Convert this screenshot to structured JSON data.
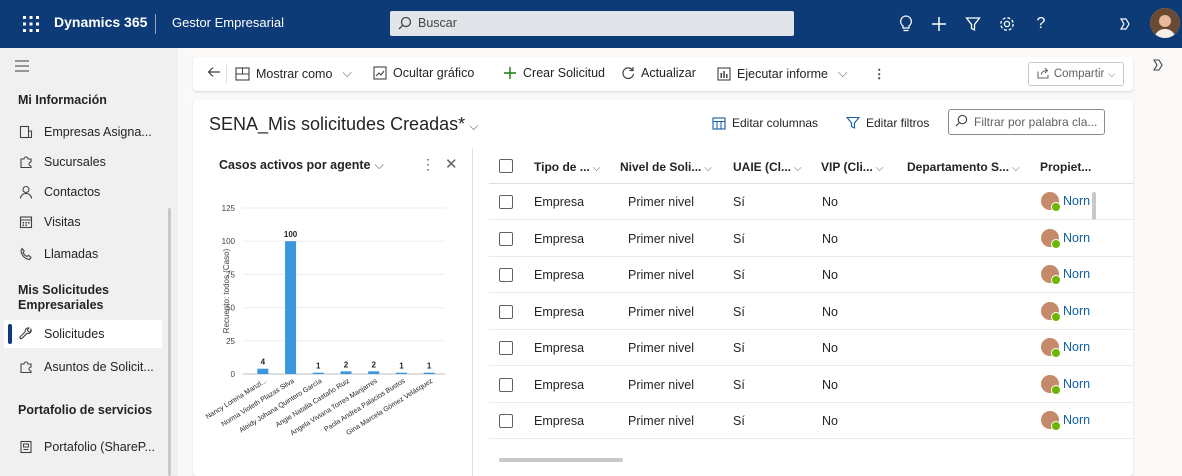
{
  "topbar": {
    "app_name": "Dynamics 365",
    "module": "Gestor Empresarial",
    "search_placeholder": "Buscar"
  },
  "sidebar": {
    "section1": "Mi Información",
    "items1": [
      {
        "label": "Empresas Asigna...",
        "icon": "building-icon"
      },
      {
        "label": "Sucursales",
        "icon": "puzzle-icon"
      },
      {
        "label": "Contactos",
        "icon": "person-icon"
      },
      {
        "label": "Visitas",
        "icon": "calendar-icon"
      },
      {
        "label": "Llamadas",
        "icon": "phone-icon"
      }
    ],
    "section2": "Mis Solicitudes Empresariales",
    "items2": [
      {
        "label": "Solicitudes",
        "icon": "wrench-icon",
        "active": true
      },
      {
        "label": "Asuntos de Solicit...",
        "icon": "puzzle-icon"
      }
    ],
    "section3": "Portafolio de servicios",
    "items3": [
      {
        "label": "Portafolio (ShareP...",
        "icon": "document-icon"
      }
    ]
  },
  "commandbar": {
    "show_as": "Mostrar como",
    "hide_chart": "Ocultar gráfico",
    "create": "Crear Solicitud",
    "refresh": "Actualizar",
    "run_report": "Ejecutar informe",
    "share": "Compartir"
  },
  "view": {
    "title": "SENA_Mis solicitudes Creadas*",
    "edit_columns": "Editar columnas",
    "edit_filters": "Editar filtros",
    "filter_placeholder": "Filtrar por palabra cla..."
  },
  "chart_panel": {
    "title": "Casos activos por agente"
  },
  "chart_data": {
    "type": "bar",
    "ylabel": "Recuento: todos (Caso)",
    "ylim": [
      0,
      125
    ],
    "yticks": [
      0,
      25,
      50,
      75,
      100,
      125
    ],
    "categories": [
      "Nancy Lorena Manzl...",
      "Norma Violeth Plazas Silva",
      "Aleidy Johana Quintero García",
      "Angie Natalia Castaño Ruiz",
      "Angela Viviana Torres Manjarres",
      "Paola Andrea Palacios Bustos",
      "Gina Marcela Gómez Velásquez"
    ],
    "values": [
      4,
      100,
      1,
      2,
      2,
      1,
      1
    ],
    "color": "#3a96dd",
    "grid": true
  },
  "grid": {
    "columns": [
      "Tipo de ...",
      "Nivel de Soli...",
      "UAIE (Cl...",
      "VIP (Cli...",
      "Departamento S...",
      "Propiet..."
    ],
    "rows": [
      {
        "tipo": "Empresa",
        "nivel": "Primer nivel",
        "uaie": "Sí",
        "vip": "No",
        "depto": "",
        "owner": "Norn"
      },
      {
        "tipo": "Empresa",
        "nivel": "Primer nivel",
        "uaie": "Sí",
        "vip": "No",
        "depto": "",
        "owner": "Norn"
      },
      {
        "tipo": "Empresa",
        "nivel": "Primer nivel",
        "uaie": "Sí",
        "vip": "No",
        "depto": "",
        "owner": "Norn"
      },
      {
        "tipo": "Empresa",
        "nivel": "Primer nivel",
        "uaie": "Sí",
        "vip": "No",
        "depto": "",
        "owner": "Norn"
      },
      {
        "tipo": "Empresa",
        "nivel": "Primer nivel",
        "uaie": "Sí",
        "vip": "No",
        "depto": "",
        "owner": "Norn"
      },
      {
        "tipo": "Empresa",
        "nivel": "Primer nivel",
        "uaie": "Sí",
        "vip": "No",
        "depto": "",
        "owner": "Norn"
      },
      {
        "tipo": "Empresa",
        "nivel": "Primer nivel",
        "uaie": "Sí",
        "vip": "No",
        "depto": "",
        "owner": "Norn"
      }
    ]
  },
  "colors": {
    "topbar": "#0c3b78",
    "accent": "#115ea3",
    "presence": "#6bb700"
  }
}
